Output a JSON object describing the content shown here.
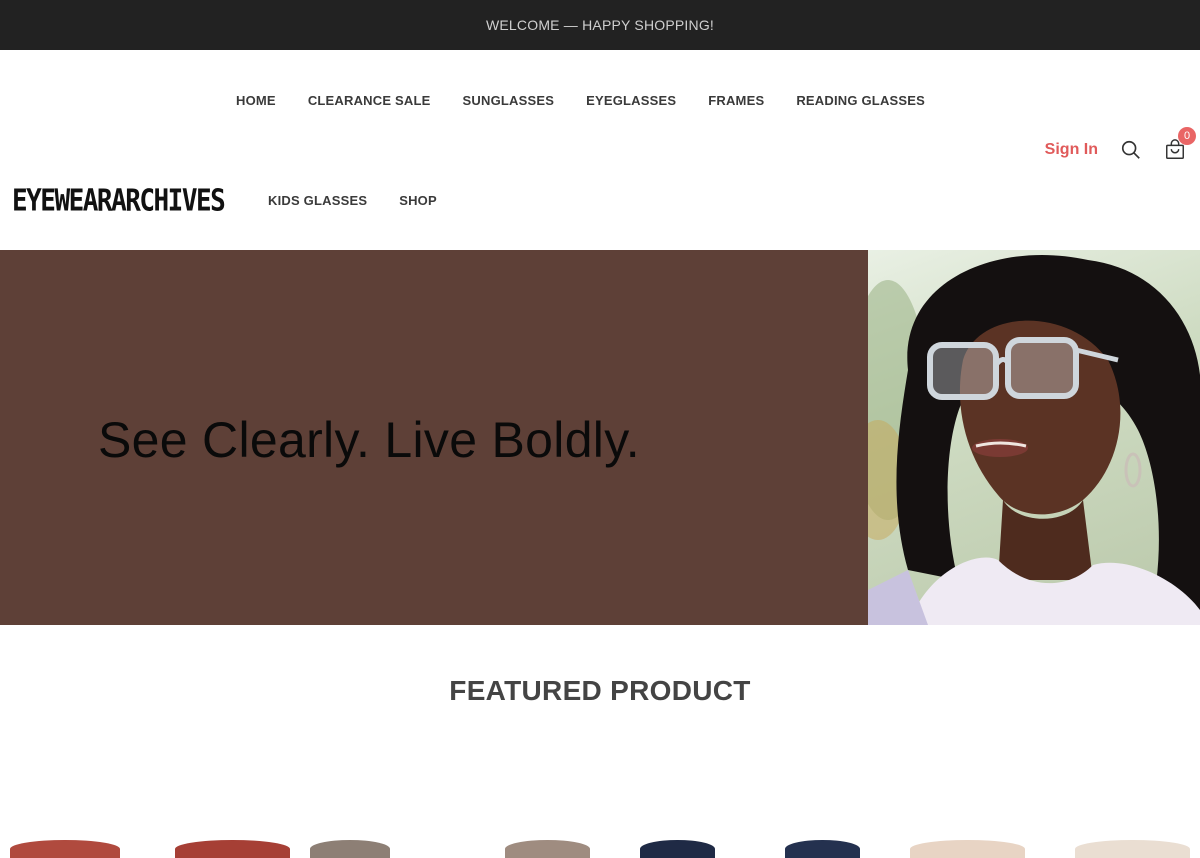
{
  "announcement": "WELCOME — HAPPY SHOPPING!",
  "brand": {
    "logo_text": "EYEWEARARCHIVES"
  },
  "nav": {
    "row1": [
      "HOME",
      "CLEARANCE SALE",
      "SUNGLASSES",
      "EYEGLASSES",
      "FRAMES",
      "READING GLASSES"
    ],
    "row2": [
      "KIDS GLASSES",
      "SHOP"
    ]
  },
  "header_actions": {
    "sign_in": "Sign In",
    "search_icon": "search-icon",
    "cart_icon": "shopping-bag-icon",
    "cart_count": "0"
  },
  "hero": {
    "headline": "See Clearly. Live Boldly.",
    "background_color": "#5e4037"
  },
  "featured": {
    "heading": "FEATURED PRODUCT"
  },
  "colors": {
    "topbar": "#222222",
    "accent": "#e05a5a",
    "badge": "#e96565"
  }
}
